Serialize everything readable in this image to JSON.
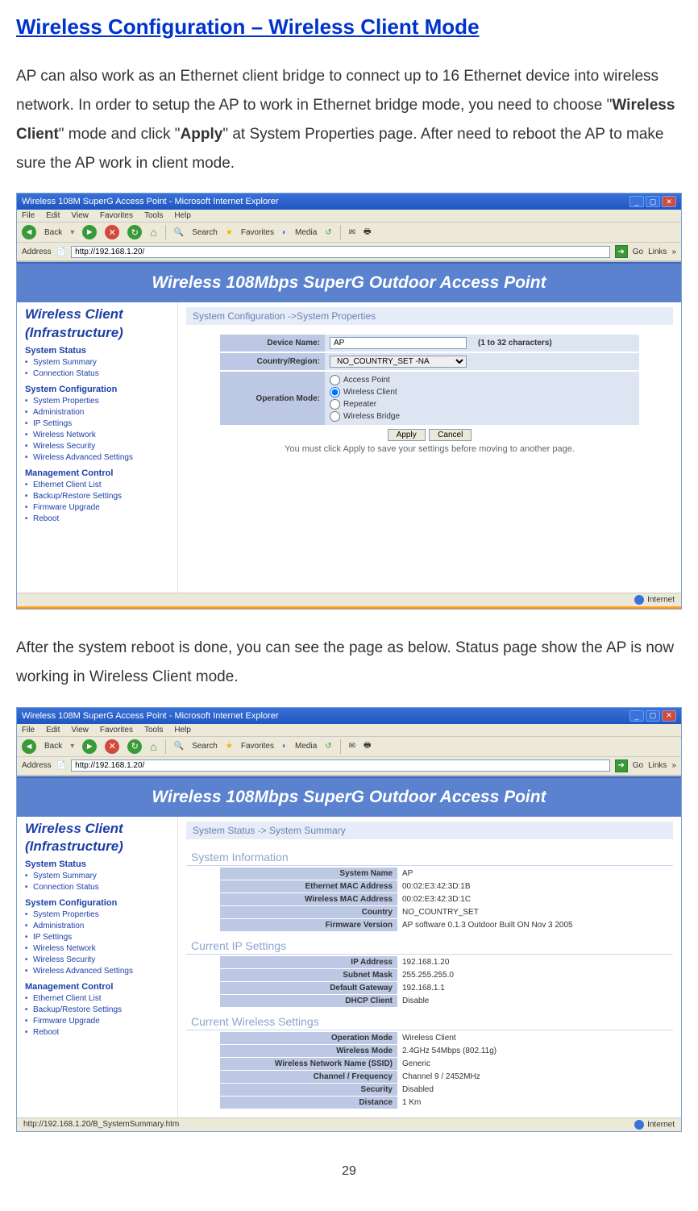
{
  "doc": {
    "title": "Wireless Configuration – Wireless Client Mode",
    "para1_a": "AP can also work as an Ethernet client bridge to connect up to 16 Ethernet device into wireless network. In order to setup the AP to work in Ethernet bridge mode, you need to choose \"",
    "para1_b": "Wireless Client",
    "para1_c": "\" mode and click \"",
    "para1_d": "Apply",
    "para1_e": "\" at System Properties page. After need to reboot the AP to make sure the AP work in client mode.",
    "para2": "After the system reboot is done, you can see the page as below. Status page show the AP is now working in Wireless Client mode.",
    "page_number": "29"
  },
  "shot1": {
    "window_title": "Wireless 108M SuperG Access Point - Microsoft Internet Explorer",
    "menus": [
      "File",
      "Edit",
      "View",
      "Favorites",
      "Tools",
      "Help"
    ],
    "toolbar": {
      "back": "Back",
      "search": "Search",
      "favorites": "Favorites",
      "media": "Media"
    },
    "address_label": "Address",
    "address_value": "http://192.168.1.20/",
    "go": "Go",
    "links": "Links",
    "banner": "Wireless 108Mbps SuperG Outdoor Access Point",
    "side_title1": "Wireless Client",
    "side_title2": "(Infrastructure)",
    "g1": "System Status",
    "g1_items": [
      "System Summary",
      "Connection Status"
    ],
    "g2": "System Configuration",
    "g2_items": [
      "System Properties",
      "Administration",
      "IP Settings",
      "Wireless Network",
      "Wireless Security",
      "Wireless Advanced Settings"
    ],
    "g3": "Management Control",
    "g3_items": [
      "Ethernet Client List",
      "Backup/Restore Settings",
      "Firmware Upgrade",
      "Reboot"
    ],
    "breadcrumb": "System Configuration ->System Properties",
    "form": {
      "device_name_label": "Device Name:",
      "device_name_value": "AP",
      "device_hint": "(1 to 32 characters)",
      "country_label": "Country/Region:",
      "country_value": "NO_COUNTRY_SET -NA",
      "opmode_label": "Operation Mode:",
      "opmodes": [
        "Access Point",
        "Wireless Client",
        "Repeater",
        "Wireless Bridge"
      ],
      "apply": "Apply",
      "cancel": "Cancel",
      "note": "You must click Apply to save your settings before moving to another page."
    },
    "status_right": "Internet"
  },
  "shot2": {
    "window_title": "Wireless 108M SuperG Access Point - Microsoft Internet Explorer",
    "address_value": "http://192.168.1.20/",
    "banner": "Wireless 108Mbps SuperG Outdoor Access Point",
    "breadcrumb": "System Status -> System Summary",
    "sec1": "System Information",
    "sec1_rows": [
      {
        "k": "System Name",
        "v": "AP"
      },
      {
        "k": "Ethernet MAC Address",
        "v": "00:02:E3:42:3D:1B"
      },
      {
        "k": "Wireless MAC Address",
        "v": "00:02:E3:42:3D:1C"
      },
      {
        "k": "Country",
        "v": "NO_COUNTRY_SET"
      },
      {
        "k": "Firmware Version",
        "v": "AP software 0.1.3 Outdoor Built ON Nov 3 2005"
      }
    ],
    "sec2": "Current IP Settings",
    "sec2_rows": [
      {
        "k": "IP Address",
        "v": "192.168.1.20"
      },
      {
        "k": "Subnet Mask",
        "v": "255.255.255.0"
      },
      {
        "k": "Default Gateway",
        "v": "192.168.1.1"
      },
      {
        "k": "DHCP Client",
        "v": "Disable"
      }
    ],
    "sec3": "Current Wireless Settings",
    "sec3_rows": [
      {
        "k": "Operation Mode",
        "v": "Wireless Client"
      },
      {
        "k": "Wireless Mode",
        "v": "2.4GHz 54Mbps (802.11g)"
      },
      {
        "k": "Wireless Network Name (SSID)",
        "v": "Generic"
      },
      {
        "k": "Channel / Frequency",
        "v": "Channel 9 / 2452MHz"
      },
      {
        "k": "Security",
        "v": "Disabled"
      },
      {
        "k": "Distance",
        "v": "1 Km"
      }
    ],
    "status_left": "http://192.168.1.20/B_SystemSummary.htm",
    "status_right": "Internet"
  }
}
